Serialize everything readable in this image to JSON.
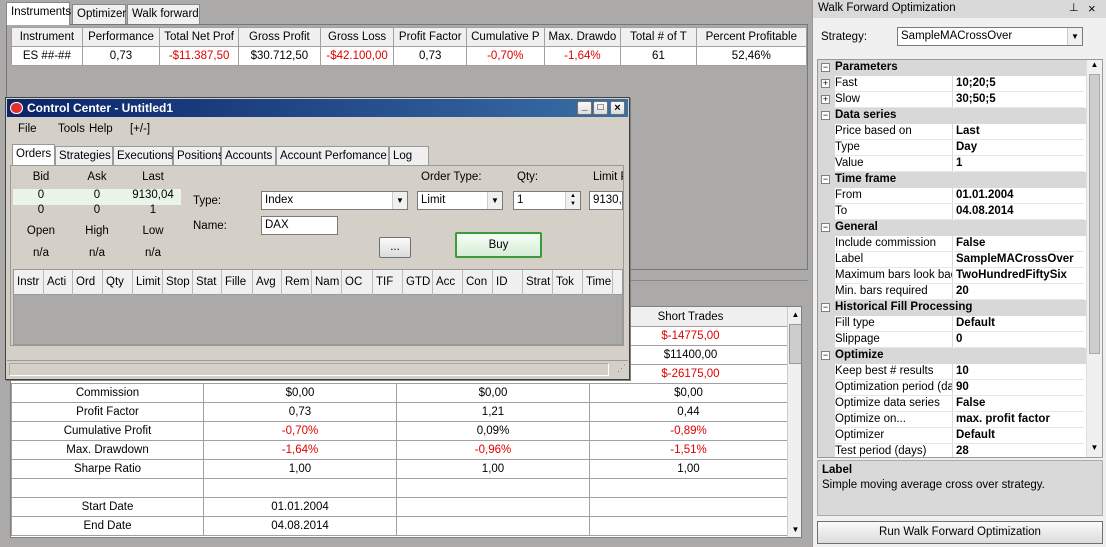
{
  "main_tabs": [
    "Instruments",
    "Optimizer",
    "Walk forward"
  ],
  "summary": {
    "headers": [
      "Instrument",
      "Performance",
      "Total Net Prof",
      "Gross Profit",
      "Gross Loss",
      "Profit Factor",
      "Cumulative P",
      "Max. Drawdo",
      "Total # of T",
      "Percent Profitable"
    ],
    "row": [
      "ES ##-##",
      "0,73",
      "-$11.387,50",
      "$30.712,50",
      "-$42.100,00",
      "0,73",
      "-0,70%",
      "-1,64%",
      "61",
      "52,46%"
    ]
  },
  "results": {
    "short_header": "Short Trades",
    "top_rows": [
      "$-14775,00",
      "$11400,00",
      "$-26175,00"
    ],
    "rows": [
      [
        "Commission",
        "$0,00",
        "$0,00",
        "$0,00"
      ],
      [
        "Profit Factor",
        "0,73",
        "1,21",
        "0,44"
      ],
      [
        "Cumulative Profit",
        "-0,70%",
        "0,09%",
        "-0,89%"
      ],
      [
        "Max. Drawdown",
        "-1,64%",
        "-0,96%",
        "-1,51%"
      ],
      [
        "Sharpe Ratio",
        "1,00",
        "1,00",
        "1,00"
      ],
      [
        "",
        "",
        "",
        ""
      ],
      [
        "Start Date",
        "01.01.2004",
        "",
        ""
      ],
      [
        "End Date",
        "04.08.2014",
        "",
        ""
      ]
    ]
  },
  "control_center": {
    "title": "Control Center - Untitled1",
    "menu": [
      "File",
      "Tools",
      "Help",
      "[+/-]"
    ],
    "tabs": [
      "Orders",
      "Strategies",
      "Executions",
      "Positions",
      "Accounts",
      "Account Perfomance",
      "Log"
    ],
    "quote_headers": [
      "Bid",
      "Ask",
      "Last"
    ],
    "quote_rows": [
      [
        "0",
        "0",
        "9130,04"
      ],
      [
        "0",
        "0",
        "1"
      ]
    ],
    "ohl_headers": [
      "Open",
      "High",
      "Low"
    ],
    "ohl_values": [
      "n/a",
      "n/a",
      "n/a"
    ],
    "type_label": "Type:",
    "type_value": "Index",
    "name_label": "Name:",
    "name_value": "DAX",
    "order_type_label": "Order Type:",
    "order_type_value": "Limit",
    "qty_label": "Qty:",
    "qty_value": "1",
    "limit_label": "Limit P",
    "limit_value": "9130,0",
    "ellipsis_label": "...",
    "buy_label": "Buy",
    "order_columns": [
      "Instr",
      "Acti",
      "Ord",
      "Qty",
      "Limit",
      "Stop",
      "Stat",
      "Fille",
      "Avg",
      "Rem",
      "Nam",
      "OC",
      "TIF",
      "GTD",
      "Acc",
      "Con",
      "ID",
      "Strat",
      "Tok",
      "Time"
    ]
  },
  "wfo": {
    "title": "Walk Forward Optimization",
    "strategy_label": "Strategy:",
    "strategy_value": "SampleMACrossOver",
    "groups": [
      {
        "name": "Parameters",
        "rows": [
          {
            "k": "Fast",
            "v": "10;20;5",
            "expand": true
          },
          {
            "k": "Slow",
            "v": "30;50;5",
            "expand": true
          }
        ]
      },
      {
        "name": "Data series",
        "rows": [
          {
            "k": "Price based on",
            "v": "Last"
          },
          {
            "k": "Type",
            "v": "Day"
          },
          {
            "k": "Value",
            "v": "1"
          }
        ]
      },
      {
        "name": "Time frame",
        "rows": [
          {
            "k": "From",
            "v": "01.01.2004"
          },
          {
            "k": "To",
            "v": "04.08.2014"
          }
        ]
      },
      {
        "name": "General",
        "rows": [
          {
            "k": "Include commission",
            "v": "False"
          },
          {
            "k": "Label",
            "v": "SampleMACrossOver"
          },
          {
            "k": "Maximum bars look bac",
            "v": "TwoHundredFiftySix"
          },
          {
            "k": "Min. bars required",
            "v": "20"
          }
        ]
      },
      {
        "name": "Historical Fill Processing",
        "rows": [
          {
            "k": "Fill type",
            "v": "Default"
          },
          {
            "k": "Slippage",
            "v": "0"
          }
        ]
      },
      {
        "name": "Optimize",
        "rows": [
          {
            "k": "Keep best # results",
            "v": "10"
          },
          {
            "k": "Optimization period (da",
            "v": "90"
          },
          {
            "k": "Optimize data series",
            "v": "False"
          },
          {
            "k": "Optimize on...",
            "v": "max. profit factor"
          },
          {
            "k": "Optimizer",
            "v": "Default"
          },
          {
            "k": "Test period (days)",
            "v": "28"
          }
        ]
      }
    ],
    "help_title": "Label",
    "help_text": "Simple moving average cross over strategy.",
    "run_label": "Run Walk Forward Optimization"
  },
  "colors": {
    "negative": "#e00000",
    "title_bar": "#0a246a",
    "buy_border": "#3c9a3c"
  }
}
